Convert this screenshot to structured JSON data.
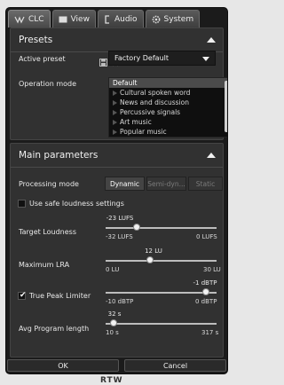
{
  "tabs": [
    {
      "label": "CLC",
      "icon": "clc-icon"
    },
    {
      "label": "View",
      "icon": "monitor-icon"
    },
    {
      "label": "Audio",
      "icon": "audio-icon"
    },
    {
      "label": "System",
      "icon": "gear-icon"
    }
  ],
  "presets": {
    "title": "Presets",
    "active_preset_label": "Active preset",
    "active_preset_value": "Factory Default",
    "operation_mode_label": "Operation mode",
    "operation_modes": [
      "Default",
      "Cultural spoken word",
      "News and discussion",
      "Percussive signals",
      "Art music",
      "Popular music"
    ],
    "selected_operation_mode": "Default"
  },
  "main": {
    "title": "Main parameters",
    "processing_mode_label": "Processing mode",
    "processing_modes": [
      "Dynamic",
      "Semi-dyn...",
      "Static"
    ],
    "processing_mode_selected": "Dynamic",
    "safe_loudness_label": "Use safe loudness settings",
    "safe_loudness_checked": false,
    "target_loudness": {
      "label": "Target Loudness",
      "value_text": "-23 LUFS",
      "min_text": "-32 LUFS",
      "max_text": "0 LUFS",
      "value": -23,
      "min": -32,
      "max": 0
    },
    "max_lra": {
      "label": "Maximum LRA",
      "value_text": "12 LU",
      "min_text": "0 LU",
      "max_text": "30 LU",
      "value": 12,
      "min": 0,
      "max": 30
    },
    "true_peak": {
      "label": "True Peak Limiter",
      "checked": true,
      "value_text": "-1 dBTP",
      "min_text": "-10 dBTP",
      "max_text": "0 dBTP",
      "value": -1,
      "min": -10,
      "max": 0
    },
    "avg_program": {
      "label": "Avg Program length",
      "value_text": "32 s",
      "min_text": "10 s",
      "max_text": "317 s",
      "value": 32,
      "min": 10,
      "max": 317
    }
  },
  "footer": {
    "ok_label": "OK",
    "cancel_label": "Cancel"
  },
  "logo_text": "RTW"
}
